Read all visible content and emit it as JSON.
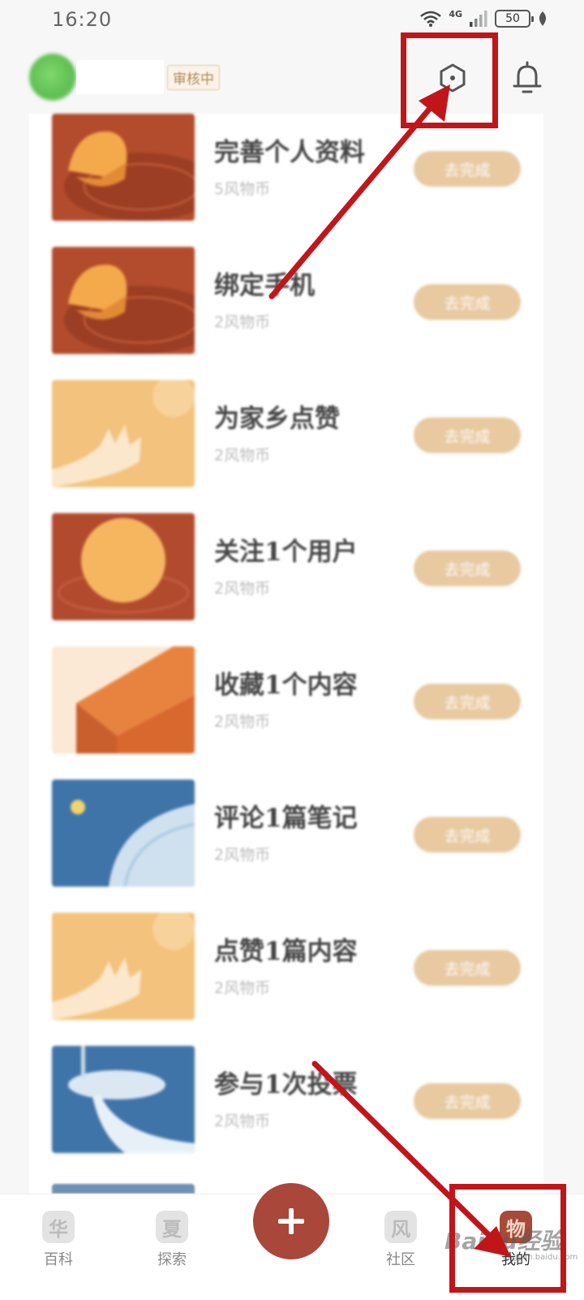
{
  "status_bar": {
    "time": "16:20",
    "network": "4G",
    "battery": "50"
  },
  "header": {
    "badge": "审核中",
    "settings_icon": "hexagon-settings-icon",
    "bell_icon": "bell-icon"
  },
  "tasks": [
    {
      "title": "完善个人资料",
      "reward": "5风物币",
      "button": "去完成",
      "thumb": "coin-plate"
    },
    {
      "title": "绑定手机",
      "reward": "2风物币",
      "button": "去完成",
      "thumb": "coin-plate"
    },
    {
      "title": "为家乡点赞",
      "reward": "2风物币",
      "button": "去完成",
      "thumb": "hand-yellow"
    },
    {
      "title": "关注1个用户",
      "reward": "2风物币",
      "button": "去完成",
      "thumb": "sun-red"
    },
    {
      "title": "收藏1个内容",
      "reward": "2风物币",
      "button": "去完成",
      "thumb": "box-orange"
    },
    {
      "title": "评论1篇笔记",
      "reward": "2风物币",
      "button": "去完成",
      "thumb": "fan-blue"
    },
    {
      "title": "点赞1篇内容",
      "reward": "2风物币",
      "button": "去完成",
      "thumb": "hand-yellow"
    },
    {
      "title": "参与1次投票",
      "reward": "2风物币",
      "button": "去完成",
      "thumb": "ribbon-blue"
    }
  ],
  "bottom_nav": {
    "items": [
      {
        "label": "百科",
        "glyph": "华"
      },
      {
        "label": "探索",
        "glyph": "夏"
      },
      {
        "label": "社区",
        "glyph": "风"
      },
      {
        "label": "我的",
        "glyph": "物"
      }
    ],
    "add_icon": "plus-icon",
    "active_index": 3
  },
  "watermark": {
    "main": "Baidu经验",
    "sub": "jingyan.baidu.com"
  },
  "colors": {
    "accent": "#a8473a",
    "button": "#e8c9a0",
    "annotation": "#c0161a"
  }
}
